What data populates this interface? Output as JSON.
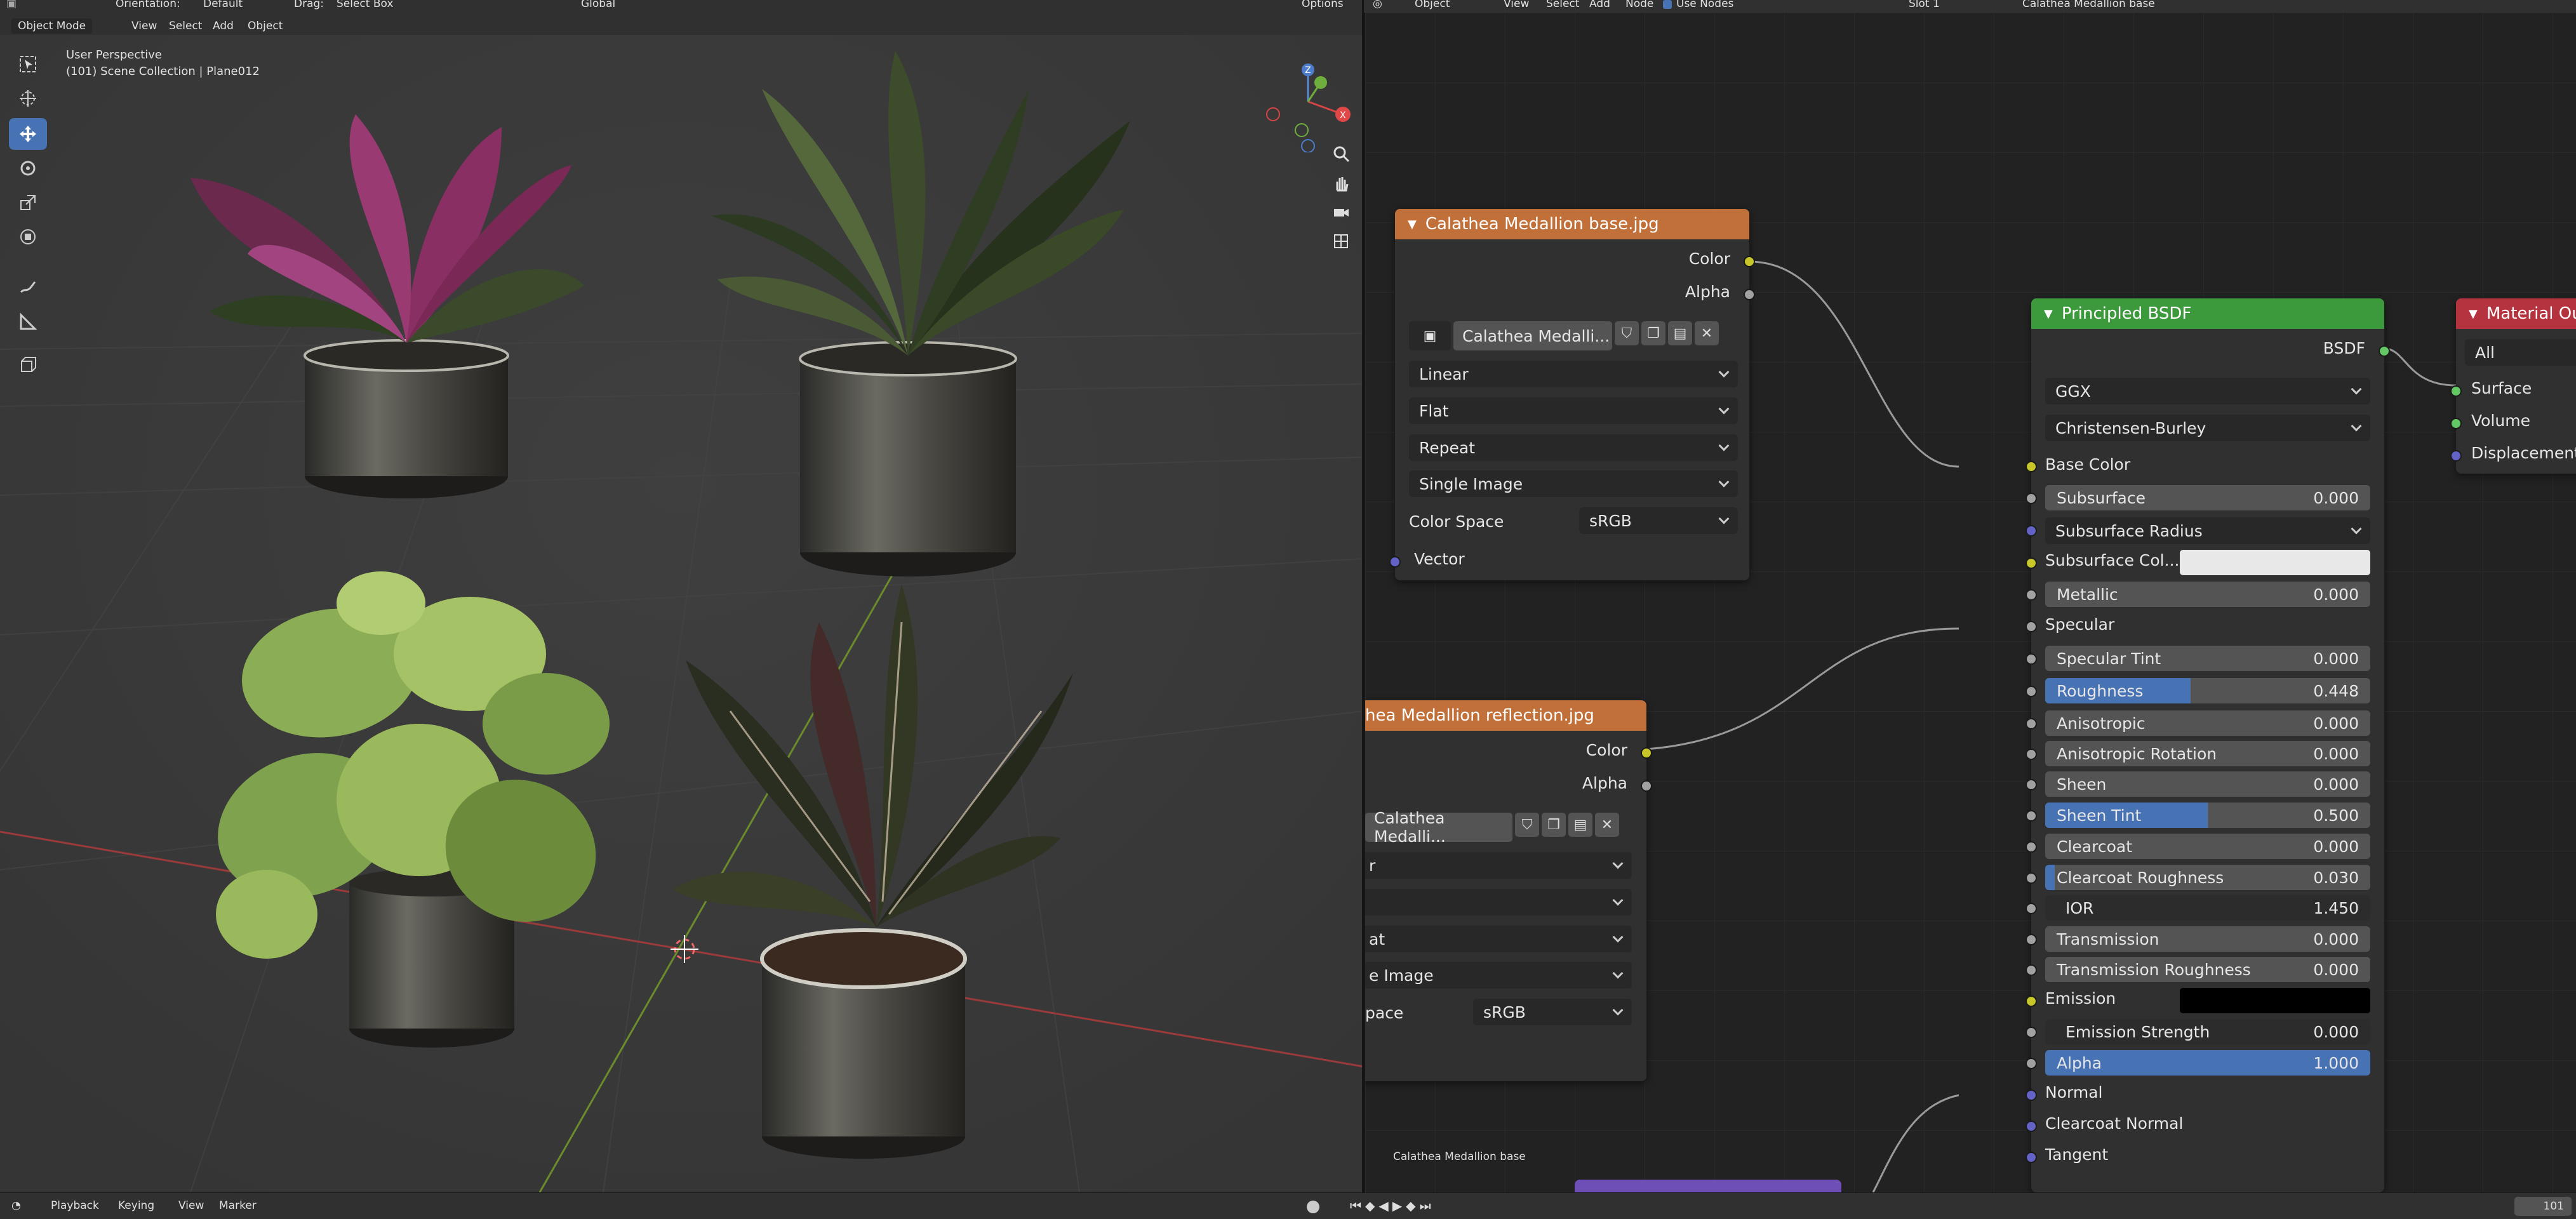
{
  "viewport_header": {
    "mode": "Object Mode",
    "menus": [
      "View",
      "Select",
      "Add",
      "Object"
    ],
    "orientation_label": "Orientation:",
    "orientation_value": "Default",
    "drag_label": "Drag:",
    "drag_value": "Select Box",
    "transform_space": "Global",
    "options": "Options"
  },
  "viewport": {
    "perspective": "User Perspective",
    "collection": "(101) Scene Collection | Plane012"
  },
  "node_header": {
    "type": "Object",
    "menus": [
      "View",
      "Select",
      "Add",
      "Node"
    ],
    "use_nodes": "Use Nodes",
    "slot": "Slot 1",
    "material": "Calathea Medallion base"
  },
  "node_base": {
    "title": "Calathea Medallion base.jpg",
    "out_color": "Color",
    "out_alpha": "Alpha",
    "image_name": "Calathea Medalli...",
    "interpolation": "Linear",
    "projection": "Flat",
    "extension": "Repeat",
    "source": "Single Image",
    "color_space_label": "Color Space",
    "color_space": "sRGB",
    "in_vector": "Vector"
  },
  "node_reflection": {
    "title": "hea Medallion reflection.jpg",
    "out_color": "Color",
    "out_alpha": "Alpha",
    "image_name": "Calathea Medalli...",
    "r1": "r",
    "r2": "",
    "r3": "at",
    "r4": "e Image",
    "color_space_label": "pace",
    "color_space": "sRGB"
  },
  "principled": {
    "title": "Principled BSDF",
    "out": "BSDF",
    "distribution": "GGX",
    "subsurface_method": "Christensen-Burley",
    "base_color": "Base Color",
    "subsurface_radius": "Subsurface Radius",
    "subsurface_color": "Subsurface Col...",
    "specular": "Specular",
    "emission": "Emission",
    "normal": "Normal",
    "clearcoat_normal": "Clearcoat Normal",
    "tangent": "Tangent",
    "fields": [
      {
        "label": "Subsurface",
        "value": "0.000",
        "fill": 0.0
      },
      {
        "label": "Metallic",
        "value": "0.000",
        "fill": 0.0
      },
      {
        "label": "Specular Tint",
        "value": "0.000",
        "fill": 0.0
      },
      {
        "label": "Roughness",
        "value": "0.448",
        "fill": 0.448
      },
      {
        "label": "Anisotropic",
        "value": "0.000",
        "fill": 0.0
      },
      {
        "label": "Anisotropic Rotation",
        "value": "0.000",
        "fill": 0.0
      },
      {
        "label": "Sheen",
        "value": "0.000",
        "fill": 0.0
      },
      {
        "label": "Sheen Tint",
        "value": "0.500",
        "fill": 0.5
      },
      {
        "label": "Clearcoat",
        "value": "0.000",
        "fill": 0.0
      },
      {
        "label": "Clearcoat Roughness",
        "value": "0.030",
        "fill": 0.03
      },
      {
        "label": "IOR",
        "value": "1.450",
        "fill": 0.0
      },
      {
        "label": "Transmission",
        "value": "0.000",
        "fill": 0.0
      },
      {
        "label": "Transmission Roughness",
        "value": "0.000",
        "fill": 0.0
      },
      {
        "label": "Emission Strength",
        "value": "0.000",
        "fill": 0.0
      },
      {
        "label": "Alpha",
        "value": "1.000",
        "fill": 1.0
      }
    ]
  },
  "output_node": {
    "title": "Material Ou",
    "target": "All",
    "surface": "Surface",
    "volume": "Volume",
    "displacement": "Displacement"
  },
  "node_tree_label": "Calathea Medallion base",
  "timeline": {
    "menus": [
      "Playback",
      "Keying",
      "View",
      "Marker"
    ],
    "frame": "101"
  },
  "colors": {
    "accent": "#4772b3",
    "texture_header": "#c2703a",
    "shader_header": "#3c9a3c",
    "output_header": "#b5333f",
    "socket_yellow": "#c7c729",
    "socket_gray": "#a1a1a1",
    "socket_blue": "#6363c7",
    "socket_green": "#63c763"
  }
}
